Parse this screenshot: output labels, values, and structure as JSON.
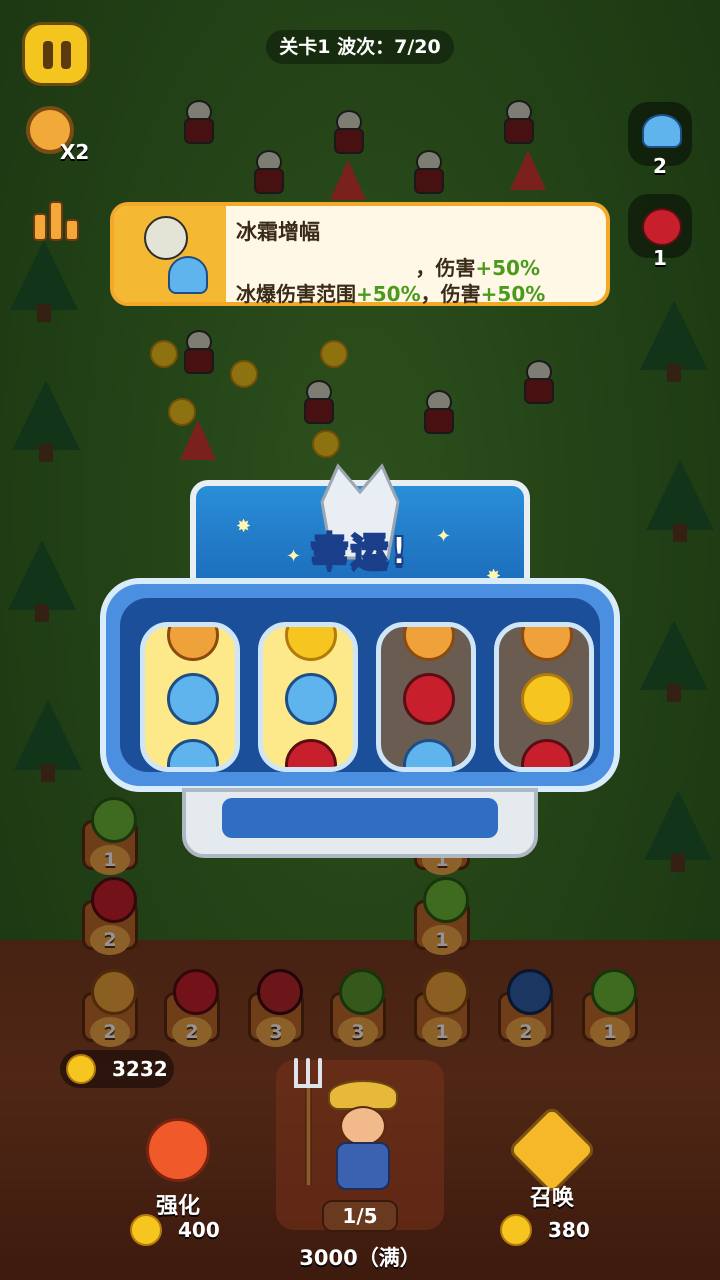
{
  "hud": {
    "level_wave": "关卡1 波次：7/20",
    "speed_label": "X2",
    "side_items": [
      {
        "icon": "mushroom-icon",
        "count": "2"
      },
      {
        "icon": "cherry-bomb-icon",
        "count": "1"
      }
    ]
  },
  "banner": {
    "title": "冰霜增幅",
    "line1_prefix": "，伤害",
    "line1_value": "+50%",
    "line2_prefix": "冰爆伤害范围",
    "line2_value": "+50%",
    "line2_mid": "，伤害",
    "line2_value2": "+50%"
  },
  "slot": {
    "title": "幸运!",
    "reels": [
      {
        "state": "lit",
        "symbols": [
          "flower",
          "mushroom",
          "mushroom"
        ]
      },
      {
        "state": "lit",
        "symbols": [
          "coin",
          "mushroom",
          "cherry"
        ]
      },
      {
        "state": "dark",
        "symbols": [
          "flower",
          "cherry",
          "mushroom"
        ]
      },
      {
        "state": "dark",
        "symbols": [
          "flower",
          "coin",
          "cherry"
        ]
      }
    ]
  },
  "board": {
    "field_counts": [
      "1",
      "1",
      "2",
      "1"
    ],
    "row_counts": [
      "2",
      "2",
      "3",
      "3",
      "1",
      "2",
      "1"
    ],
    "coins": "3232",
    "upgrade": {
      "label": "强化",
      "cost": "400"
    },
    "summon": {
      "label": "召唤",
      "cost": "380"
    },
    "summon_progress": "1/5",
    "capacity": "3000（满）"
  },
  "colors": {
    "accent_yellow": "#f4c51e",
    "slot_blue": "#4b8fe0",
    "bonus_green": "#4a9a1e"
  }
}
